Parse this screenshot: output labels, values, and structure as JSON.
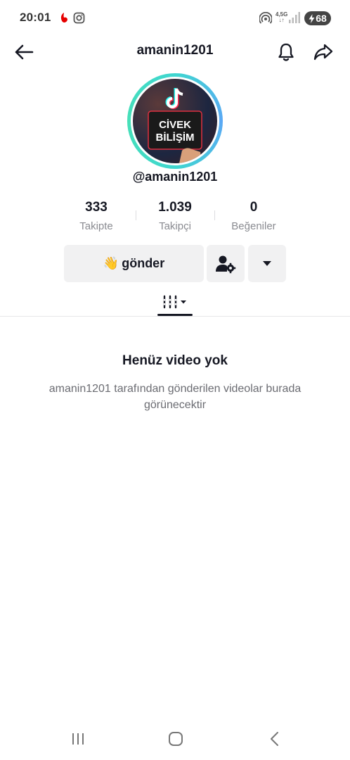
{
  "status_bar": {
    "time": "20:01",
    "network": "4,5G",
    "battery": "68"
  },
  "header": {
    "title": "amanin1201"
  },
  "profile": {
    "avatar_text_line1": "CİVEK",
    "avatar_text_line2": "BİLİŞİM",
    "handle": "@amanin1201"
  },
  "stats": [
    {
      "value": "333",
      "label": "Takipte"
    },
    {
      "value": "1.039",
      "label": "Takipçi"
    },
    {
      "value": "0",
      "label": "Beğeniler"
    }
  ],
  "actions": {
    "send_label": "gönder",
    "send_emoji": "👋"
  },
  "empty_state": {
    "title": "Henüz video yok",
    "description": "amanin1201 tarafından gönderilen videolar burada görünecektir"
  }
}
